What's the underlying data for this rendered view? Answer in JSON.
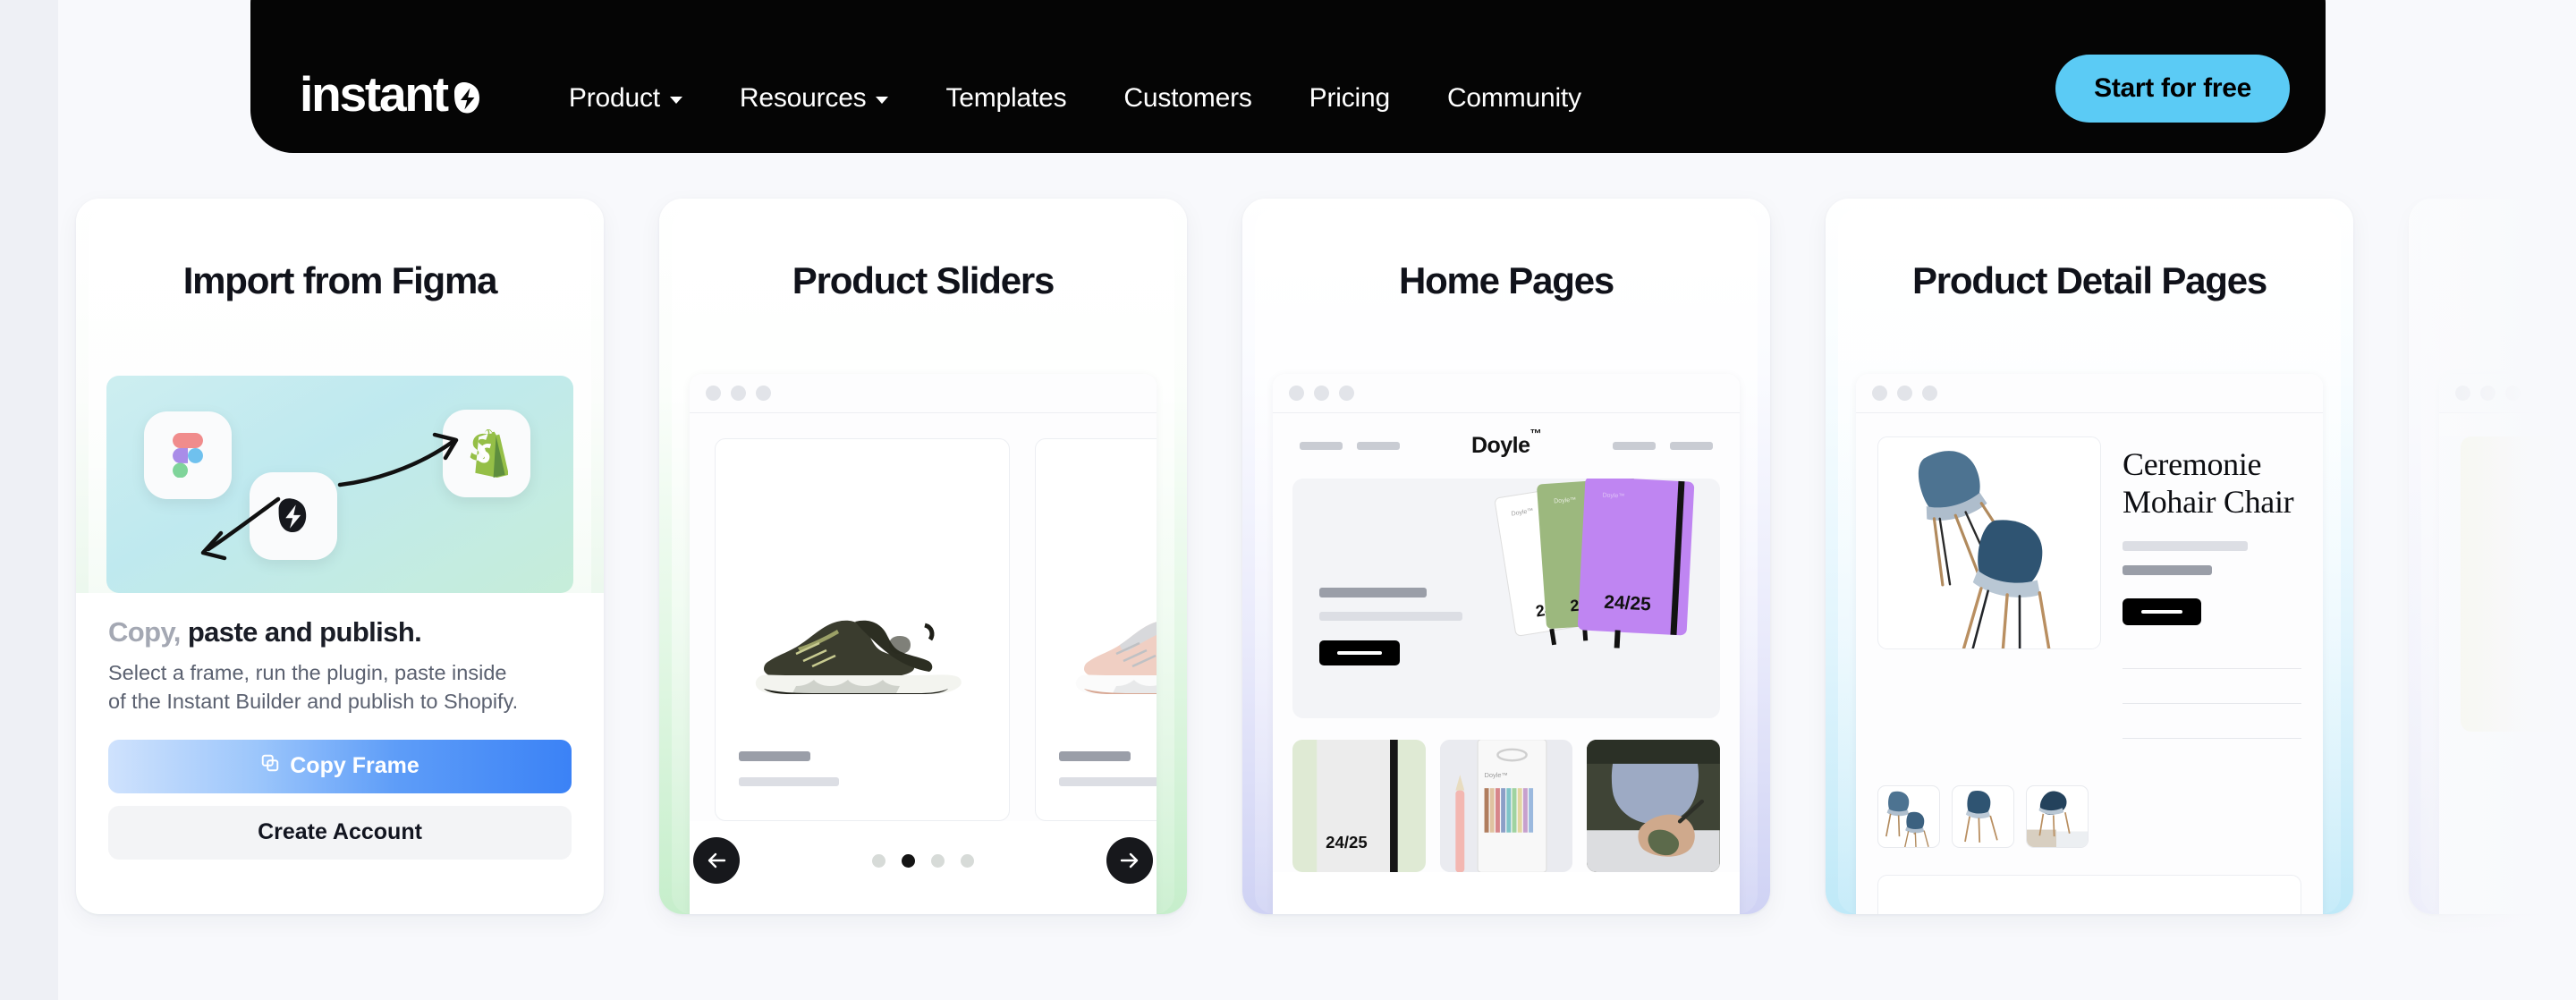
{
  "brand": {
    "name": "instant",
    "mark": "instant-lightning-mark"
  },
  "nav": {
    "items": [
      {
        "label": "Product",
        "has_dropdown": true
      },
      {
        "label": "Resources",
        "has_dropdown": true
      },
      {
        "label": "Templates",
        "has_dropdown": false
      },
      {
        "label": "Customers",
        "has_dropdown": false
      },
      {
        "label": "Pricing",
        "has_dropdown": false
      },
      {
        "label": "Community",
        "has_dropdown": false
      }
    ],
    "cta": {
      "label": "Start for free",
      "color": "#5BCBF5"
    },
    "background": "#050505"
  },
  "cards": [
    {
      "title": "Import from Figma",
      "accent": "#d3f0d8",
      "apps": [
        "figma-icon",
        "shopify-icon",
        "instant-icon"
      ],
      "body": {
        "headline_muted": "Copy,",
        "headline_bold": "paste and publish.",
        "description_line1": "Select a frame, run the plugin, paste inside",
        "description_line2": "of the Instant Builder and publish to Shopify.",
        "primary_button": "Copy Frame",
        "secondary_button": "Create Account"
      }
    },
    {
      "title": "Product Sliders",
      "accent": "#c6eecb",
      "carousel": {
        "prev_label": "←",
        "next_label": "→",
        "dot_count": 4,
        "active_dot": 2
      }
    },
    {
      "title": "Home Pages",
      "accent": "#cfd2f4",
      "store": {
        "brand": "Doyle",
        "brand_tm": "™",
        "product_badge": "24/25",
        "thumb_badge": "24/25"
      }
    },
    {
      "title": "Product Detail Pages",
      "accent": "#bfe9f8",
      "product": {
        "name_line1": "Ceremonie",
        "name_line2": "Mohair Chair"
      }
    },
    {
      "title": "",
      "accent": "#e2e3f7"
    }
  ]
}
